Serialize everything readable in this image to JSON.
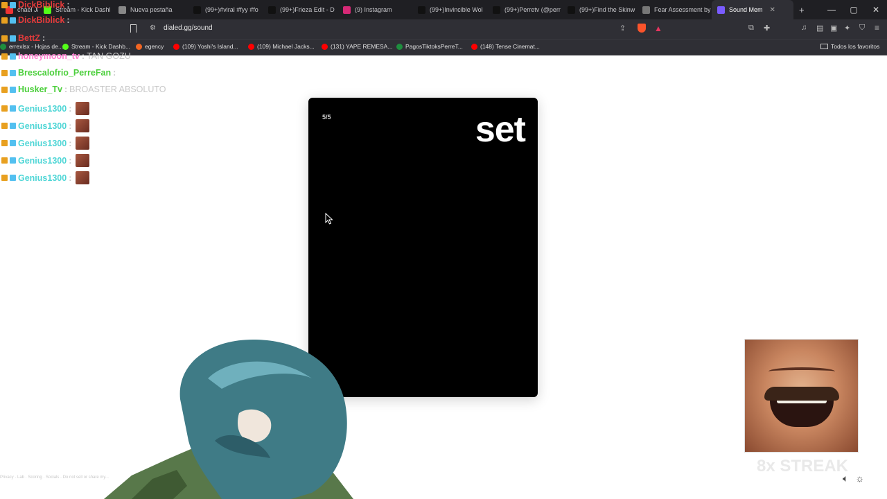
{
  "browser": {
    "tabs": [
      {
        "label": "chael Jacks...",
        "active": false,
        "color": "#e33"
      },
      {
        "label": "Stream - Kick Dashl",
        "active": false,
        "color": "#53fc18"
      },
      {
        "label": "Nueva pestaña",
        "active": false,
        "color": "#888"
      },
      {
        "label": "(99+)#viral #fyy #fo",
        "active": false,
        "color": "#111"
      },
      {
        "label": "(99+)Frieza Edit - D",
        "active": false,
        "color": "#111"
      },
      {
        "label": "(9) Instagram",
        "active": false,
        "color": "#d62976"
      },
      {
        "label": "(99+)Invincible Wol",
        "active": false,
        "color": "#111"
      },
      {
        "label": "(99+)Perretv (@perr",
        "active": false,
        "color": "#111"
      },
      {
        "label": "(99+)Find the Skinw",
        "active": false,
        "color": "#111"
      },
      {
        "label": "Fear Assessment by",
        "active": false,
        "color": "#777"
      },
      {
        "label": "Sound Mem",
        "active": true,
        "color": "#7a5cff"
      }
    ],
    "new_tab_symbol": "+",
    "window_controls": [
      "—",
      "▢",
      "✕"
    ],
    "url": "dialed.gg/sound",
    "bookmarks": [
      {
        "label": "errexlsx - Hojas de...",
        "color": "#1e8e3e"
      },
      {
        "label": "Stream - Kick Dashb...",
        "color": "#53fc18"
      },
      {
        "label": "egency",
        "color": "#f26522"
      },
      {
        "label": "(109) Yoshi's Island...",
        "color": "#ff0000"
      },
      {
        "label": "(109) Michael Jacks...",
        "color": "#ff0000"
      },
      {
        "label": "(131) YAPE REMESA...",
        "color": "#ff0000"
      },
      {
        "label": "PagosTiktoksPerreT...",
        "color": "#1e8e3e"
      },
      {
        "label": "(148) Tense Cinemat...",
        "color": "#ff0000"
      }
    ],
    "favorites_label": "Todos los favoritos"
  },
  "chat": [
    {
      "user": "DickBiblick",
      "message": "",
      "color": "#e33b3b"
    },
    {
      "user": "DickBiblick",
      "message": "",
      "color": "#e33b3b"
    },
    {
      "user": "BettZ",
      "message": "",
      "color": "#e33b3b"
    },
    {
      "user": "honeymoon_tv",
      "message": "TAN GOZU",
      "color": "#ff7fd0"
    },
    {
      "user": "Brescalofrio_PerreFan",
      "message": "",
      "color": "#4ccf3c"
    },
    {
      "user": "Husker_Tv",
      "message": "BROASTER ABSOLUTO",
      "color": "#4ccf3c"
    },
    {
      "user": "Genius1300",
      "message": "",
      "color": "#4fd6d6"
    },
    {
      "user": "Genius1300",
      "message": "",
      "color": "#4fd6d6"
    },
    {
      "user": "Genius1300",
      "message": "",
      "color": "#4fd6d6"
    },
    {
      "user": "Genius1300",
      "message": "",
      "color": "#4fd6d6"
    },
    {
      "user": "Genius1300",
      "message": "",
      "color": "#4fd6d6"
    }
  ],
  "game": {
    "progress": "5/5",
    "word": "set"
  },
  "overlay": {
    "streak": "8x STREAK"
  },
  "footer": {
    "links": "Privacy · Lab · Scoring · Socials · Do not sell or share my..."
  }
}
